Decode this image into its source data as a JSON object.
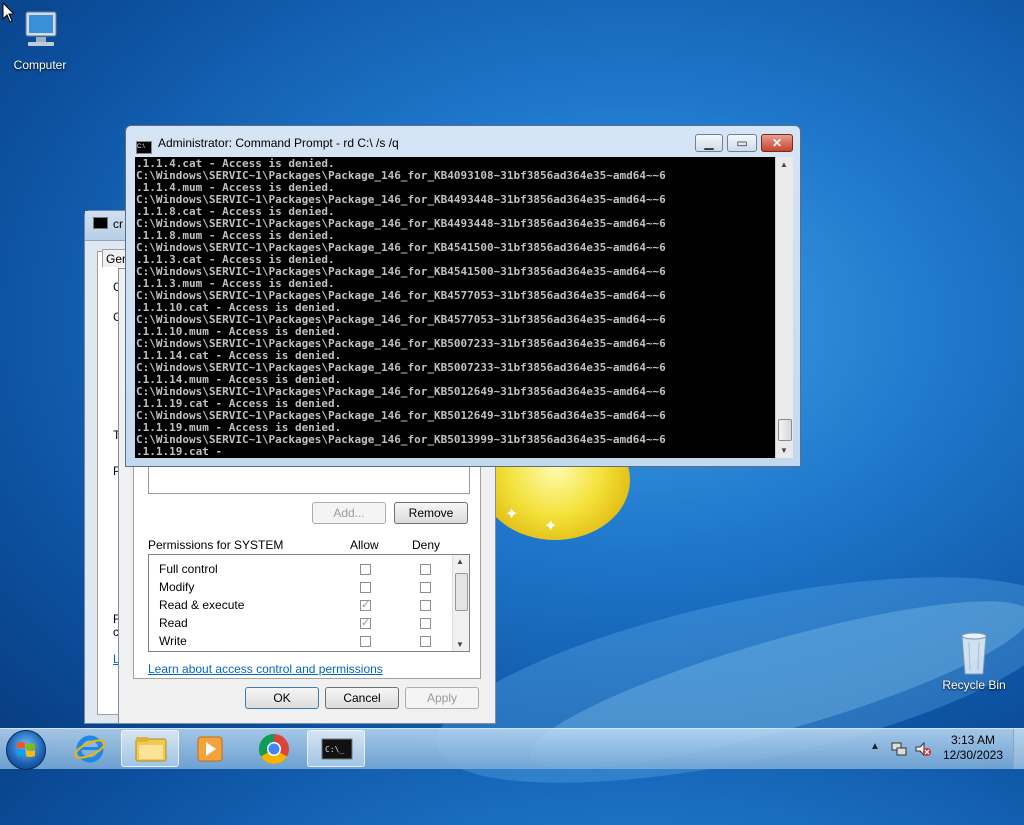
{
  "desktop": {
    "icons": [
      {
        "label": "Computer",
        "icon": "computer-icon"
      },
      {
        "label": "Recycle Bin",
        "icon": "recycle-bin-icon"
      }
    ]
  },
  "properties_dialog": {
    "title_partial": "cr",
    "tab_partial": "Gen",
    "add_button": "Add...",
    "remove_button": "Remove",
    "permissions_label": "Permissions for SYSTEM",
    "allow_header": "Allow",
    "deny_header": "Deny",
    "permissions": [
      {
        "name": "Full control",
        "allow": false,
        "deny": false
      },
      {
        "name": "Modify",
        "allow": false,
        "deny": false
      },
      {
        "name": "Read & execute",
        "allow": true,
        "deny": false
      },
      {
        "name": "Read",
        "allow": true,
        "deny": false
      },
      {
        "name": "Write",
        "allow": false,
        "deny": false
      }
    ],
    "link": "Learn about access control and permissions",
    "ok_button": "OK",
    "cancel_button": "Cancel",
    "apply_button": "Apply",
    "side_letters": [
      "G",
      "G",
      "T",
      "P",
      "F",
      "c",
      "L"
    ]
  },
  "cmd_window": {
    "title": "Administrator: Command Prompt - rd  C:\\ /s /q",
    "lines": [
      ".1.1.4.cat - Access is denied.",
      "C:\\Windows\\SERVIC~1\\Packages\\Package_146_for_KB4093108~31bf3856ad364e35~amd64~~6",
      ".1.1.4.mum - Access is denied.",
      "C:\\Windows\\SERVIC~1\\Packages\\Package_146_for_KB4493448~31bf3856ad364e35~amd64~~6",
      ".1.1.8.cat - Access is denied.",
      "C:\\Windows\\SERVIC~1\\Packages\\Package_146_for_KB4493448~31bf3856ad364e35~amd64~~6",
      ".1.1.8.mum - Access is denied.",
      "C:\\Windows\\SERVIC~1\\Packages\\Package_146_for_KB4541500~31bf3856ad364e35~amd64~~6",
      ".1.1.3.cat - Access is denied.",
      "C:\\Windows\\SERVIC~1\\Packages\\Package_146_for_KB4541500~31bf3856ad364e35~amd64~~6",
      ".1.1.3.mum - Access is denied.",
      "C:\\Windows\\SERVIC~1\\Packages\\Package_146_for_KB4577053~31bf3856ad364e35~amd64~~6",
      ".1.1.10.cat - Access is denied.",
      "C:\\Windows\\SERVIC~1\\Packages\\Package_146_for_KB4577053~31bf3856ad364e35~amd64~~6",
      ".1.1.10.mum - Access is denied.",
      "C:\\Windows\\SERVIC~1\\Packages\\Package_146_for_KB5007233~31bf3856ad364e35~amd64~~6",
      ".1.1.14.cat - Access is denied.",
      "C:\\Windows\\SERVIC~1\\Packages\\Package_146_for_KB5007233~31bf3856ad364e35~amd64~~6",
      ".1.1.14.mum - Access is denied.",
      "C:\\Windows\\SERVIC~1\\Packages\\Package_146_for_KB5012649~31bf3856ad364e35~amd64~~6",
      ".1.1.19.cat - Access is denied.",
      "C:\\Windows\\SERVIC~1\\Packages\\Package_146_for_KB5012649~31bf3856ad364e35~amd64~~6",
      ".1.1.19.mum - Access is denied.",
      "C:\\Windows\\SERVIC~1\\Packages\\Package_146_for_KB5013999~31bf3856ad364e35~amd64~~6",
      ".1.1.19.cat -"
    ]
  },
  "taskbar": {
    "apps": [
      {
        "name": "start-button"
      },
      {
        "name": "internet-explorer-icon"
      },
      {
        "name": "file-explorer-icon",
        "active": true
      },
      {
        "name": "media-player-icon"
      },
      {
        "name": "chrome-icon"
      },
      {
        "name": "command-prompt-icon",
        "active": true
      }
    ],
    "time": "3:13 AM",
    "date": "12/30/2023"
  }
}
